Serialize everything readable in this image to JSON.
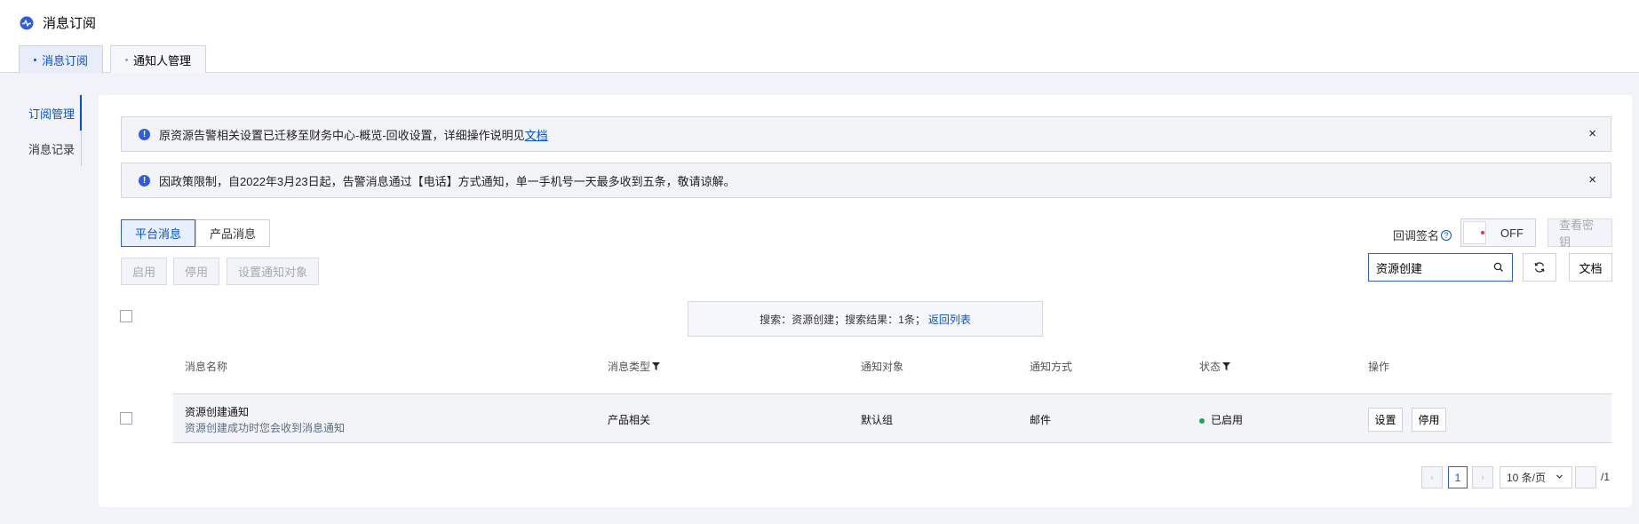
{
  "app": {
    "title": "消息订阅"
  },
  "tabs": [
    {
      "label": "消息订阅",
      "active": true
    },
    {
      "label": "通知人管理",
      "active": false
    }
  ],
  "sidebar": {
    "items": [
      {
        "label": "订阅管理",
        "active": true
      },
      {
        "label": "消息记录",
        "active": false
      }
    ]
  },
  "alerts": [
    {
      "text": "原资源告警相关设置已迁移至财务中心-概览-回收设置，详细操作说明见",
      "link": "文档",
      "close": "×"
    },
    {
      "text": "因政策限制，自2022年3月23日起，告警消息通过【电话】方式通知，单一手机号一天最多收到五条，敬请谅解。",
      "close": "×"
    }
  ],
  "segments": [
    {
      "label": "平台消息",
      "active": true
    },
    {
      "label": "产品消息",
      "active": false
    }
  ],
  "toolbar": {
    "enable_label": "启用",
    "disable_label": "停用",
    "set_target_label": "设置通知对象",
    "callback_sign_label": "回调签名",
    "callback_sign_help": "?",
    "toggle_state": "OFF",
    "view_key_label": "查看密钥",
    "search_value": "资源创建",
    "docs_label": "文档"
  },
  "search_result": {
    "text": "搜索：资源创建；搜索结果：1条；",
    "back_link": "返回列表"
  },
  "table": {
    "columns": [
      "消息名称",
      "消息类型",
      "通知对象",
      "通知方式",
      "状态",
      "操作"
    ],
    "rows": [
      {
        "name": "资源创建通知",
        "description": "资源创建成功时您会收到消息通知",
        "type": "产品相关",
        "target": "默认组",
        "method": "邮件",
        "status": "已启用",
        "actions": [
          "设置",
          "停用"
        ]
      }
    ]
  },
  "pagination": {
    "prev": "‹",
    "current_page": "1",
    "next": "›",
    "page_size": "10 条/页",
    "total_pages": "/1"
  },
  "colors": {
    "accent": "#0052d9",
    "status_enabled": "#21a34a",
    "toggle_dot": "#e23b3b"
  }
}
